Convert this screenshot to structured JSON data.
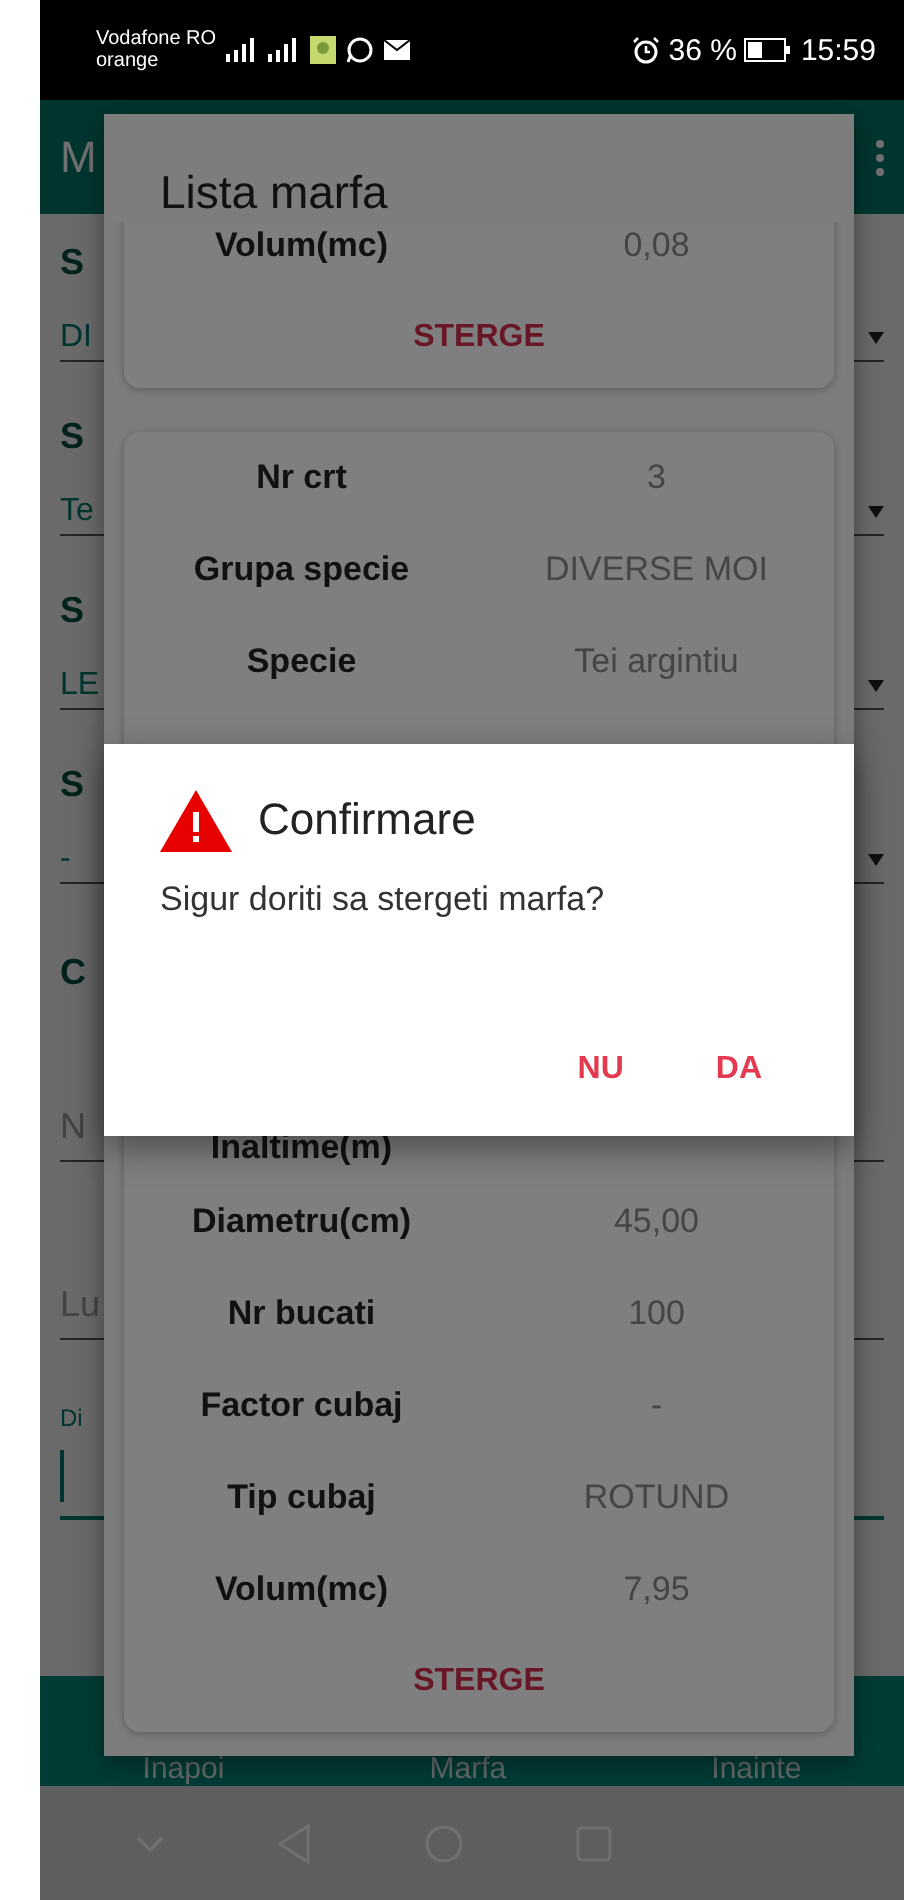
{
  "status_bar": {
    "carrier": "Vodafone RO",
    "carrier_2": "orange",
    "battery": "36 %",
    "time": "15:59"
  },
  "app": {
    "title": "M",
    "fields": [
      {
        "kind": "dropdown",
        "label": "S",
        "value": "DI"
      },
      {
        "kind": "dropdown",
        "label": "S",
        "value": "Te"
      },
      {
        "kind": "dropdown",
        "label": "S",
        "value": "LE"
      },
      {
        "kind": "dropdown",
        "label": "S",
        "value": "-"
      },
      {
        "kind": "section",
        "label": "C"
      },
      {
        "kind": "input",
        "placeholder": "N"
      },
      {
        "kind": "input",
        "placeholder": "Lu"
      },
      {
        "kind": "focused",
        "label": "Di"
      }
    ],
    "bottom_nav": [
      "Inapoi",
      "Marfa",
      "Inainte"
    ]
  },
  "list_dialog": {
    "title": "Lista marfa",
    "cards": [
      {
        "rows": [
          {
            "label": "Volum(mc)",
            "value": "0,08"
          }
        ],
        "action": "STERGE"
      },
      {
        "rows": [
          {
            "label": "Nr crt",
            "value": "3"
          },
          {
            "label": "Grupa specie",
            "value": "DIVERSE MOI"
          },
          {
            "label": "Specie",
            "value": "Tei argintiu"
          },
          {
            "kind": "hidden"
          },
          {
            "kind": "cut",
            "label": "Inaltime(m)"
          },
          {
            "label": "Diametru(cm)",
            "value": "45,00"
          },
          {
            "label": "Nr bucati",
            "value": "100"
          },
          {
            "label": "Factor cubaj",
            "value": "-"
          },
          {
            "label": "Tip cubaj",
            "value": "ROTUND"
          },
          {
            "label": "Volum(mc)",
            "value": "7,95"
          }
        ],
        "action": "STERGE"
      }
    ]
  },
  "confirm_dialog": {
    "title": "Confirmare",
    "message": "Sigur doriti sa stergeti marfa?",
    "buttons": [
      "NU",
      "DA"
    ]
  }
}
